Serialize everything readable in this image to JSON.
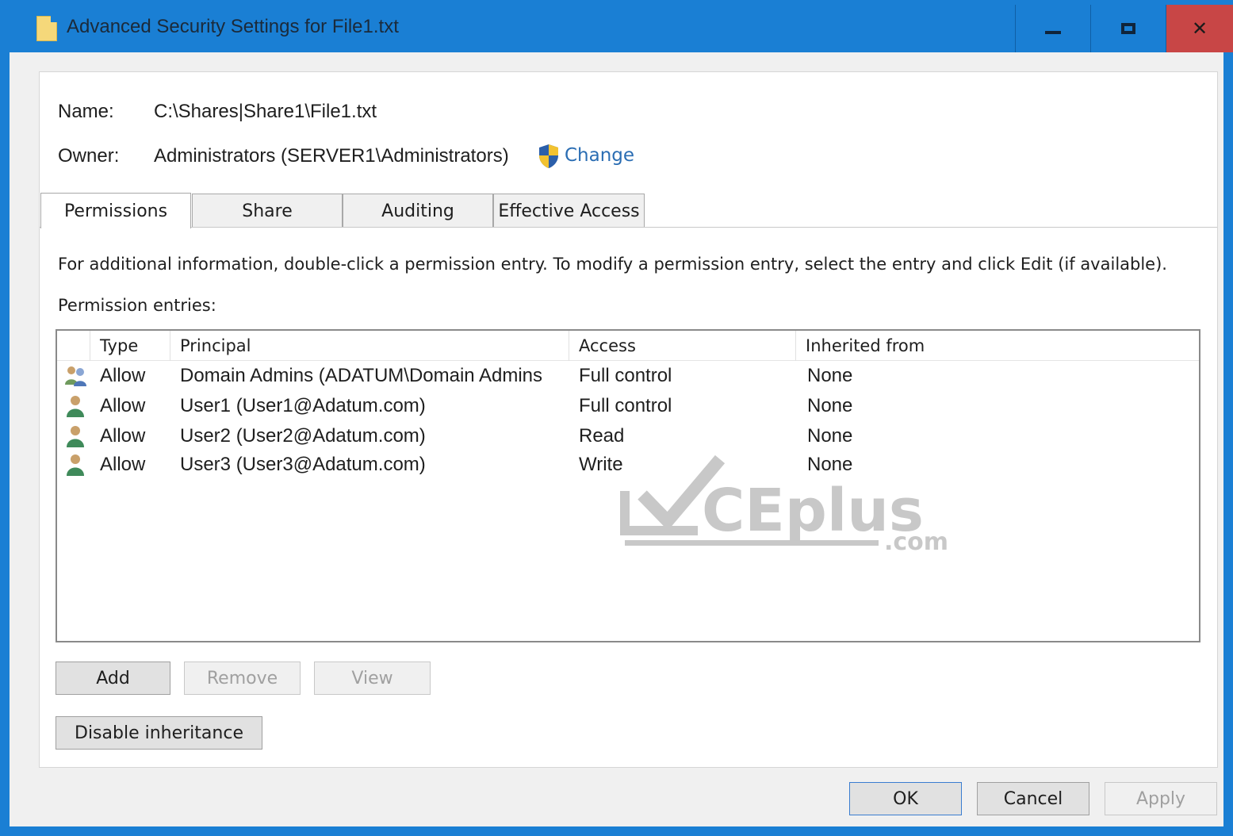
{
  "window": {
    "title": "Advanced Security Settings for  File1.txt",
    "min_label": "",
    "max_label": "",
    "close_label": "✕"
  },
  "header": {
    "name_label": "Name:",
    "name_value": "C:\\Shares|Share1\\File1.txt",
    "owner_label": "Owner:",
    "owner_value": "Administrators (SERVER1\\Administrators)",
    "change_label": "Change"
  },
  "tabs": [
    {
      "label": "Permissions",
      "active": true
    },
    {
      "label": "Share",
      "active": false
    },
    {
      "label": "Auditing",
      "active": false
    },
    {
      "label": "Effective Access",
      "active": false
    }
  ],
  "info_text": "For additional information, double-click a permission entry. To modify a permission entry, select the entry and click Edit (if available).",
  "entries_label": "Permission entries:",
  "table": {
    "columns": [
      "",
      "Type",
      "Principal",
      "Access",
      "Inherited from"
    ],
    "rows": [
      {
        "icon": "group-icon",
        "type": "Allow",
        "principal": "Domain Admins (ADATUM\\Domain Admins",
        "access": "Full control",
        "inherited": "None"
      },
      {
        "icon": "user-icon",
        "type": "Allow",
        "principal": "User1 (User1@Adatum.com)",
        "access": "Full control",
        "inherited": "None"
      },
      {
        "icon": "user-icon",
        "type": "Allow",
        "principal": "User2 (User2@Adatum.com)",
        "access": "Read",
        "inherited": "None"
      },
      {
        "icon": "user-icon",
        "type": "Allow",
        "principal": "User3 (User3@Adatum.com)",
        "access": "Write",
        "inherited": "None"
      }
    ]
  },
  "buttons": {
    "add": "Add",
    "remove": "Remove",
    "view": "View",
    "disable_inheritance": "Disable inheritance",
    "ok": "OK",
    "cancel": "Cancel",
    "apply": "Apply"
  },
  "watermark": {
    "text": "CEplus",
    "suffix": ".com"
  },
  "colors": {
    "titlebar": "#1a7fd4",
    "close_button": "#c84646",
    "link": "#2a6db3"
  }
}
